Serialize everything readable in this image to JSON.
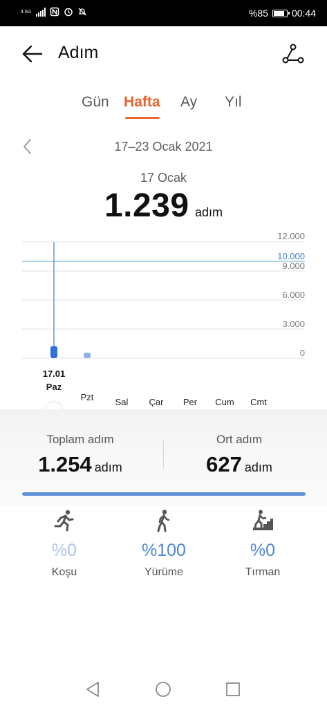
{
  "status_bar": {
    "network": "4.5G",
    "battery_text": "%85",
    "battery_level": 0.85,
    "time": "00:44"
  },
  "header": {
    "title": "Adım",
    "back_icon": "arrow-left-icon",
    "share_icon": "share-nodes-icon"
  },
  "tabs": [
    {
      "label": "Gün",
      "active": false
    },
    {
      "label": "Hafta",
      "active": true
    },
    {
      "label": "Ay",
      "active": false
    },
    {
      "label": "Yıl",
      "active": false
    }
  ],
  "range": {
    "label": "17–23 Ocak 2021",
    "prev_icon": "chevron-left-icon"
  },
  "selected": {
    "date": "17 Ocak",
    "steps": "1.239",
    "unit": "adım"
  },
  "chart_data": {
    "type": "bar",
    "categories": [
      "Paz",
      "Pzt",
      "Sal",
      "Çar",
      "Per",
      "Cum",
      "Cmt"
    ],
    "values": [
      1239,
      15,
      0,
      0,
      0,
      0,
      0
    ],
    "selected_index": 0,
    "selected_label_top": "17.01",
    "y_ticks": [
      0,
      3000,
      6000,
      9000,
      12000
    ],
    "y_tick_labels": [
      "0",
      "3.000",
      "6.000",
      "9.000",
      "12.000"
    ],
    "goal": 10000,
    "goal_label": "10.000",
    "ylim": [
      0,
      12000
    ],
    "grid": true,
    "bar_color": "#2f6fd8",
    "goal_color": "#7eb6d6"
  },
  "summary": {
    "total_label": "Toplam adım",
    "total_value": "1.254",
    "avg_label": "Ort adım",
    "avg_value": "627",
    "unit": "adım",
    "progress": 1.0
  },
  "activities": [
    {
      "icon": "running-icon",
      "percent": "%0",
      "name": "Koşu",
      "color": "#a9c7ea"
    },
    {
      "icon": "walking-icon",
      "percent": "%100",
      "name": "Yürüme",
      "color": "#4d86d2"
    },
    {
      "icon": "climbing-icon",
      "percent": "%0",
      "name": "Tırman",
      "color": "#4d86d2"
    }
  ],
  "navbar": {
    "back_icon": "nav-back-triangle-icon",
    "home_icon": "nav-home-circle-icon",
    "recents_icon": "nav-recents-square-icon"
  }
}
